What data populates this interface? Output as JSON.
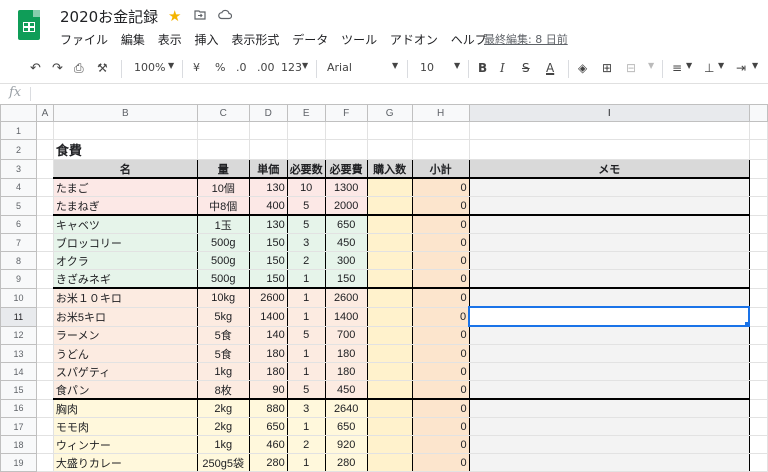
{
  "doc": {
    "title": "2020お金記録",
    "menu": [
      "ファイル",
      "編集",
      "表示",
      "挿入",
      "表示形式",
      "データ",
      "ツール",
      "アドオン",
      "ヘルプ"
    ],
    "last_edit": "最終編集: 8 日前"
  },
  "toolbar": {
    "zoom": "100%",
    "currency": "¥",
    "percent": "%",
    "dec_less": ".0",
    "dec_more": ".00",
    "format": "123",
    "font": "Arial",
    "size": "10",
    "bold": "B",
    "italic": "I",
    "strike": "S",
    "textcolor": "A"
  },
  "formula_bar": {
    "fx": "fx",
    "value": ""
  },
  "columns": [
    "A",
    "B",
    "C",
    "D",
    "E",
    "F",
    "G",
    "H",
    "I"
  ],
  "selected_cell": "I11",
  "section_title": "食費",
  "headers": [
    "名",
    "量",
    "単価",
    "必要数",
    "必要費",
    "購入数",
    "小計",
    "メモ"
  ],
  "rows": [
    {
      "name": "たまご",
      "qty": "10個",
      "price": "130",
      "need": "10",
      "cost": "1300",
      "subtotal": "0"
    },
    {
      "name": "たまねぎ",
      "qty": "中8個",
      "price": "400",
      "need": "5",
      "cost": "2000",
      "subtotal": "0"
    },
    {
      "name": "キャベツ",
      "qty": "1玉",
      "price": "130",
      "need": "5",
      "cost": "650",
      "subtotal": "0"
    },
    {
      "name": "ブロッコリー",
      "qty": "500g",
      "price": "150",
      "need": "3",
      "cost": "450",
      "subtotal": "0"
    },
    {
      "name": "オクラ",
      "qty": "500g",
      "price": "150",
      "need": "2",
      "cost": "300",
      "subtotal": "0"
    },
    {
      "name": "きざみネギ",
      "qty": "500g",
      "price": "150",
      "need": "1",
      "cost": "150",
      "subtotal": "0"
    },
    {
      "name": "お米１０キロ",
      "qty": "10kg",
      "price": "2600",
      "need": "1",
      "cost": "2600",
      "subtotal": "0"
    },
    {
      "name": "お米5キロ",
      "qty": "5kg",
      "price": "1400",
      "need": "1",
      "cost": "1400",
      "subtotal": "0"
    },
    {
      "name": "ラーメン",
      "qty": "5食",
      "price": "140",
      "need": "5",
      "cost": "700",
      "subtotal": "0"
    },
    {
      "name": "うどん",
      "qty": "5食",
      "price": "180",
      "need": "1",
      "cost": "180",
      "subtotal": "0"
    },
    {
      "name": "スパゲティ",
      "qty": "1kg",
      "price": "180",
      "need": "1",
      "cost": "180",
      "subtotal": "0"
    },
    {
      "name": "食パン",
      "qty": "8枚",
      "price": "90",
      "need": "5",
      "cost": "450",
      "subtotal": "0"
    },
    {
      "name": "胸肉",
      "qty": "2kg",
      "price": "880",
      "need": "3",
      "cost": "2640",
      "subtotal": "0"
    },
    {
      "name": "モモ肉",
      "qty": "2kg",
      "price": "650",
      "need": "1",
      "cost": "650",
      "subtotal": "0"
    },
    {
      "name": "ウィンナー",
      "qty": "1kg",
      "price": "460",
      "need": "2",
      "cost": "920",
      "subtotal": "0"
    },
    {
      "name": "大盛りカレー",
      "qty": "250g5袋",
      "price": "280",
      "need": "1",
      "cost": "280",
      "subtotal": "0"
    }
  ],
  "colors": {
    "eggs": "#fce8e6",
    "veg": "#e6f4ea",
    "staple": "#fcebe1",
    "meat": "#fff8dc",
    "buy": "#fff2cc",
    "subtotal": "#fce5cd",
    "memo": "#f3f3f3",
    "selection": "#1a73e8",
    "header_fill": "#d9d9d9"
  }
}
